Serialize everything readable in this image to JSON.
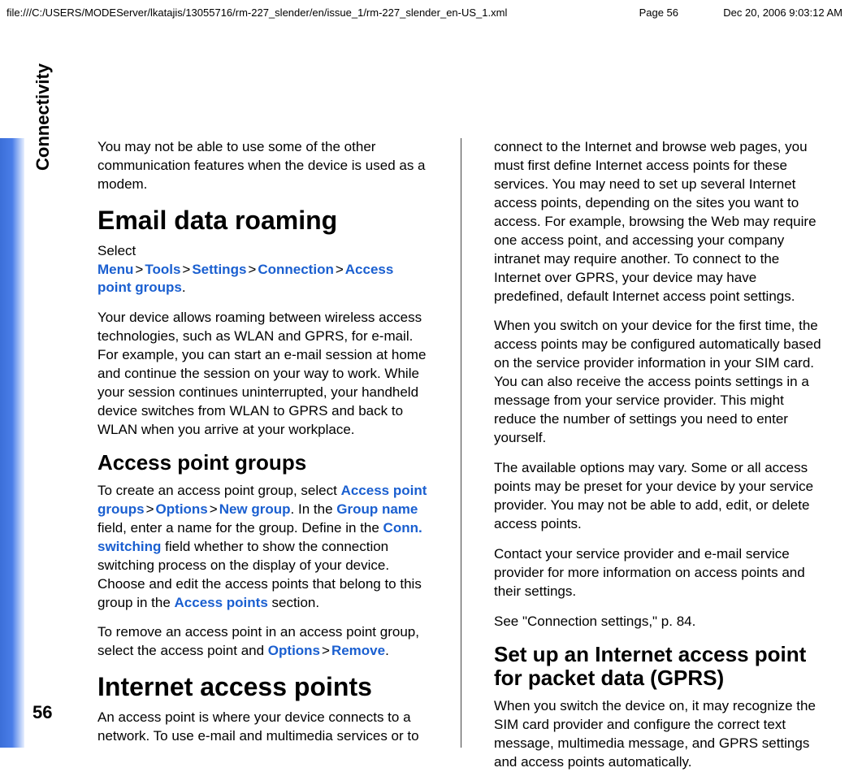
{
  "header": {
    "path": "file:///C:/USERS/MODEServer/lkatajis/13055716/rm-227_slender/en/issue_1/rm-227_slender_en-US_1.xml",
    "page": "Page 56",
    "timestamp": "Dec 20, 2006 9:03:12 AM"
  },
  "sidebar": {
    "section": "Connectivity",
    "pageNumber": "56"
  },
  "left": {
    "intro": "You may not be able to use some of the other communication features when the device is used as a modem.",
    "h1_email": "Email data roaming",
    "select_word": "Select ",
    "nav1": {
      "a": "Menu",
      "b": "Tools",
      "c": "Settings",
      "d": "Connection",
      "e": "Access point groups"
    },
    "period": ".",
    "roaming_para": "Your device allows roaming between wireless access technologies, such as WLAN and GPRS, for e-mail. For example, you can start an e-mail session at home and continue the session on your way to work. While your session continues uninterrupted, your handheld device switches from WLAN to GPRS and back to WLAN when you arrive at your workplace.",
    "h2_apg": "Access point groups",
    "apg_create_lead": "To create an access point group, select ",
    "nav2": {
      "a": "Access point groups",
      "b": "Options",
      "c": "New group"
    },
    "apg_in_the": ". In the ",
    "groupname": "Group name",
    "apg_mid": " field, enter a name for the group. Define in the ",
    "connswitch": "Conn. switching",
    "apg_mid2": " field whether to show the connection switching process on the display of your device. Choose and edit the access points that belong to this group in the ",
    "accesspoints": "Access points",
    "apg_end": " section.",
    "remove_lead": "To remove an access point in an access point group, select the access point and ",
    "nav3": {
      "a": "Options",
      "b": "Remove"
    },
    "h1_iap": "Internet access points",
    "iap_intro": "An access point is where your device connects to a network. To use e-mail and multimedia services or to"
  },
  "right": {
    "p1": "connect to the Internet and browse web pages, you must first define Internet access points for these services. You may need to set up several Internet access points, depending on the sites you want to access. For example, browsing the Web may require one access point, and accessing your company intranet may require another. To connect to the Internet over GPRS, your device may have predefined, default Internet access point settings.",
    "p2": "When you switch on your device for the first time, the access points may be configured automatically based on the service provider information in your SIM card. You can also receive the access points settings in a message from your service provider. This might reduce the number of settings you need to enter yourself.",
    "p3": "The available options may vary. Some or all access points may be preset for your device by your service provider. You may not be able to add, edit, or delete access points.",
    "p4": "Contact your service provider and e-mail service provider for more information on access points and their settings.",
    "p5": "See \"Connection settings,\" p. 84.",
    "h2_gprs": "Set up an Internet access point for packet data (GPRS)",
    "p6": "When you switch the device on, it may recognize the SIM card provider and configure the correct text message, multimedia message, and GPRS settings and access points automatically."
  },
  "sep": ">"
}
